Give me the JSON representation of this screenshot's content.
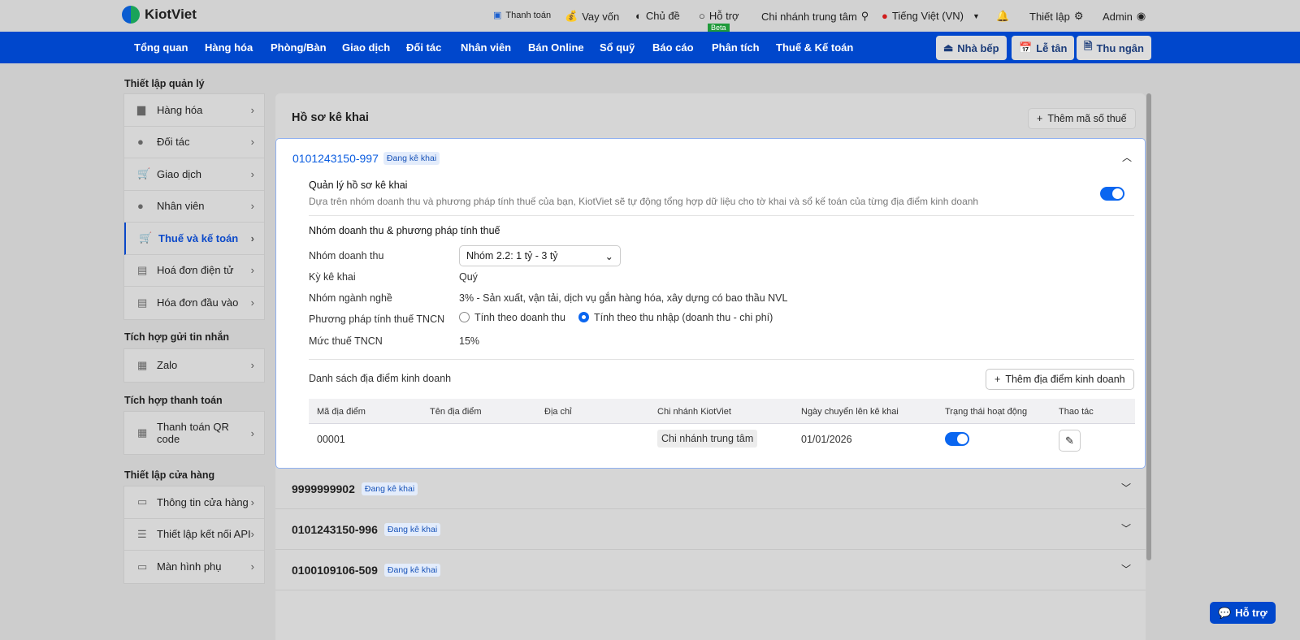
{
  "topbar": {
    "brand": "KiotViet",
    "items": [
      {
        "label": "Thanh toán",
        "icon": "payment-icon"
      },
      {
        "label": "Vay vốn",
        "icon": "money-bag-icon"
      },
      {
        "label": "Chủ đề",
        "icon": "palette-icon"
      },
      {
        "label": "Hỗ trợ",
        "icon": "chat-icon"
      },
      {
        "label": "Chi nhánh trung tâm",
        "icon": "location-icon"
      },
      {
        "label": "Tiếng Việt (VN)",
        "icon": "vn-flag-icon"
      },
      {
        "label": "Thiết lập",
        "icon": "gear-icon"
      },
      {
        "label": "Admin",
        "icon": "user-icon"
      }
    ],
    "beta": "Beta"
  },
  "nav": {
    "items": [
      "Tổng quan",
      "Hàng hóa",
      "Phòng/Bàn",
      "Giao dịch",
      "Đối tác",
      "Nhân viên",
      "Bán Online",
      "Sổ quỹ",
      "Báo cáo",
      "Phân tích",
      "Thuế & Kế toán"
    ],
    "buttons": [
      "Nhà bếp",
      "Lễ tân",
      "Thu ngân"
    ]
  },
  "sidebar": {
    "groups": [
      {
        "title": "Thiết lập quản lý",
        "items": [
          "Hàng hóa",
          "Đối tác",
          "Giao dịch",
          "Nhân viên",
          "Thuế và kế toán",
          "Hoá đơn điện tử",
          "Hóa đơn đầu vào"
        ]
      },
      {
        "title": "Tích hợp gửi tin nhắn",
        "items": [
          "Zalo"
        ]
      },
      {
        "title": "Tích hợp thanh toán",
        "items": [
          "Thanh toán QR code"
        ]
      },
      {
        "title": "Thiết lập cửa hàng",
        "items": [
          "Thông tin cửa hàng",
          "Thiết lập kết nối API",
          "Màn hình phụ"
        ]
      }
    ],
    "active": "Thuế và kế toán"
  },
  "main": {
    "title": "Hồ sơ kê khai",
    "add_tax_button": "Thêm mã số thuế",
    "expanded": {
      "id": "0101243150-997",
      "status": "Đang kê khai",
      "manage_title": "Quản lý hồ sơ kê khai",
      "manage_desc": "Dựa trên nhóm doanh thu và phương pháp tính thuế của bạn, KiotViet sẽ tự động tổng hợp dữ liệu cho tờ khai và sổ kế toán của từng địa điểm kinh doanh",
      "manage_enabled": true,
      "section_title": "Nhóm doanh thu & phương pháp tính thuế",
      "fields": {
        "revenue_group_label": "Nhóm doanh thu",
        "revenue_group_value": "Nhóm 2.2: 1 tỷ - 3 tỷ",
        "period_label": "Kỳ kê khai",
        "period_value": "Quý",
        "industry_label": "Nhóm ngành nghề",
        "industry_value": "3% - Sản xuất, vận tải, dịch vụ gắn hàng hóa, xây dựng có bao thầu NVL",
        "method_label": "Phương pháp tính thuế TNCN",
        "method_options": [
          "Tính theo doanh thu",
          "Tính theo thu nhập (doanh thu - chi phí)"
        ],
        "method_selected": 1,
        "rate_label": "Mức thuế TNCN",
        "rate_value": "15%"
      },
      "locations_title": "Danh sách địa điểm kinh doanh",
      "add_location_button": "Thêm địa điểm kinh doanh",
      "columns": [
        "Mã địa điểm",
        "Tên địa điểm",
        "Địa chỉ",
        "Chi nhánh KiotViet",
        "Ngày chuyển lên kê khai",
        "Trạng thái hoạt động",
        "Thao tác"
      ],
      "rows": [
        {
          "code": "00001",
          "name": "",
          "address": "",
          "branch": "Chi nhánh trung tâm",
          "date": "01/01/2026",
          "active": true
        }
      ]
    },
    "collapsed": [
      {
        "id": "9999999902",
        "status": "Đang kê khai"
      },
      {
        "id": "0101243150-996",
        "status": "Đang kê khai"
      },
      {
        "id": "0100109106-509",
        "status": "Đang kê khai"
      }
    ]
  },
  "help_button": "Hỗ trợ",
  "colors": {
    "nav": "#0047cc",
    "accent": "#0a66f0"
  }
}
